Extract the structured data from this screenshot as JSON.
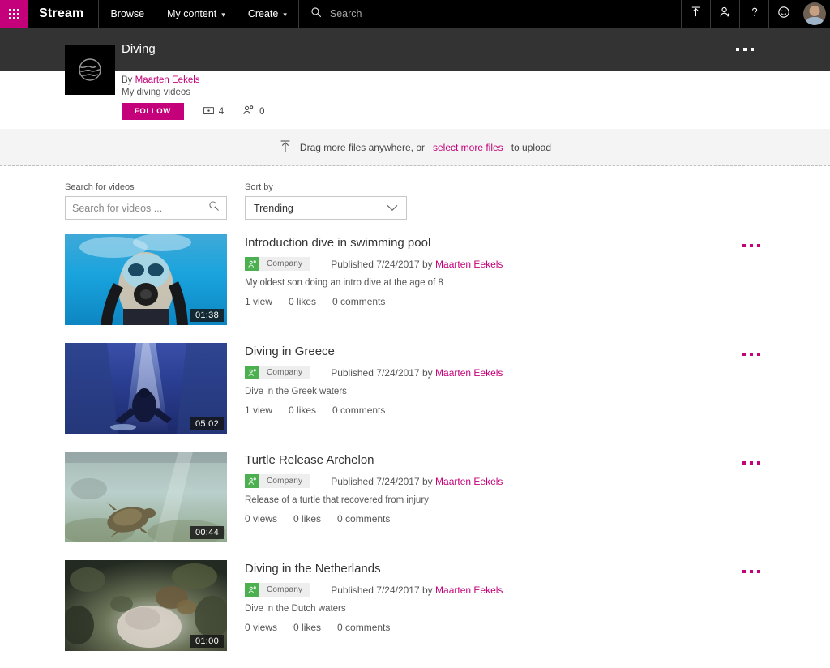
{
  "suite": {
    "waffle_label": "app-launcher",
    "brand": "Stream",
    "nav": [
      {
        "label": "Browse",
        "has_caret": false
      },
      {
        "label": "My content",
        "has_caret": true
      },
      {
        "label": "Create",
        "has_caret": true
      }
    ],
    "search_placeholder": "Search",
    "search_value": "",
    "actions": [
      "upload-icon",
      "add-person-icon",
      "help-icon",
      "feedback-icon",
      "avatar"
    ],
    "accent_color": "#c4017a"
  },
  "channel": {
    "title": "Diving",
    "by_prefix": "By",
    "author": "Maarten Eekels",
    "description": "My diving videos",
    "follow_label": "FOLLOW",
    "video_count": "4",
    "follower_count": "0",
    "more_label": "more-options"
  },
  "dropzone": {
    "text_before": "Drag more files anywhere, or",
    "link": "select more files",
    "text_after": "to upload"
  },
  "filters": {
    "search_label": "Search for videos",
    "search_placeholder": "Search for videos ...",
    "search_value": "",
    "sort_label": "Sort by",
    "sort_value": "Trending"
  },
  "videos": [
    {
      "title": "Introduction dive in swimming pool",
      "privacy_badge": "Company",
      "published_prefix": "Published",
      "published_date": "7/24/2017",
      "published_by_prefix": "by",
      "author": "Maarten Eekels",
      "description": "My oldest son doing an intro dive at the age of 8",
      "views": "1 view",
      "likes": "0 likes",
      "comments": "0 comments",
      "duration": "01:38"
    },
    {
      "title": "Diving in Greece",
      "privacy_badge": "Company",
      "published_prefix": "Published",
      "published_date": "7/24/2017",
      "published_by_prefix": "by",
      "author": "Maarten Eekels",
      "description": "Dive in the Greek waters",
      "views": "1 view",
      "likes": "0 likes",
      "comments": "0 comments",
      "duration": "05:02"
    },
    {
      "title": "Turtle Release Archelon",
      "privacy_badge": "Company",
      "published_prefix": "Published",
      "published_date": "7/24/2017",
      "published_by_prefix": "by",
      "author": "Maarten Eekels",
      "description": "Release of a turtle that recovered from injury",
      "views": "0 views",
      "likes": "0 likes",
      "comments": "0 comments",
      "duration": "00:44"
    },
    {
      "title": "Diving in the Netherlands",
      "privacy_badge": "Company",
      "published_prefix": "Published",
      "published_date": "7/24/2017",
      "published_by_prefix": "by",
      "author": "Maarten Eekels",
      "description": "Dive in the Dutch waters",
      "views": "0 views",
      "likes": "0 likes",
      "comments": "0 comments",
      "duration": "01:00"
    }
  ]
}
